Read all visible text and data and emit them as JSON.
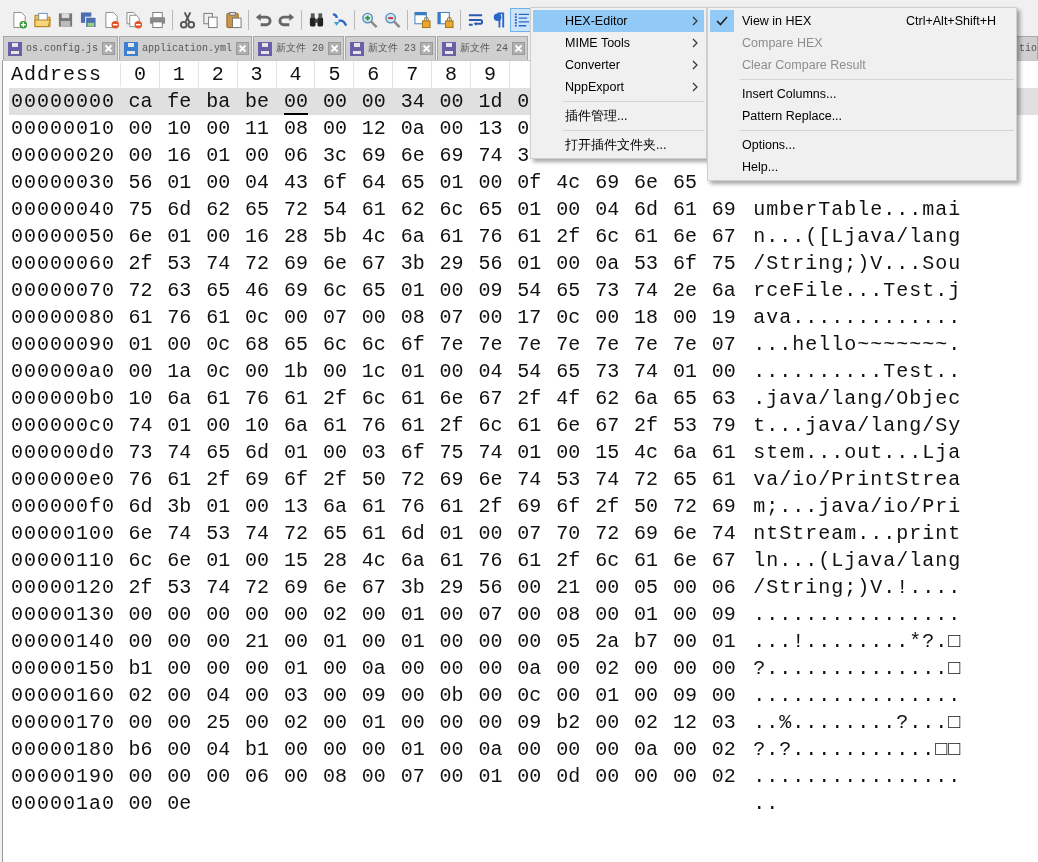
{
  "toolbar_groups": [
    [
      {
        "kind": "new",
        "selected": false
      },
      {
        "kind": "open",
        "selected": false
      },
      {
        "kind": "save",
        "selected": false
      },
      {
        "kind": "saveall",
        "selected": false
      },
      {
        "kind": "close",
        "selected": false
      },
      {
        "kind": "closeall",
        "selected": false
      },
      {
        "kind": "print",
        "selected": false
      }
    ],
    [
      {
        "kind": "cut",
        "selected": false
      },
      {
        "kind": "copy",
        "selected": false
      },
      {
        "kind": "paste",
        "selected": false
      }
    ],
    [
      {
        "kind": "undo",
        "selected": false
      },
      {
        "kind": "redo",
        "selected": false
      }
    ],
    [
      {
        "kind": "find",
        "selected": false
      },
      {
        "kind": "replace",
        "selected": false
      }
    ],
    [
      {
        "kind": "zoomin",
        "selected": false
      },
      {
        "kind": "zoomout",
        "selected": false
      }
    ],
    [
      {
        "kind": "syncv",
        "selected": false
      },
      {
        "kind": "synch",
        "selected": false
      }
    ],
    [
      {
        "kind": "wrap",
        "selected": false
      },
      {
        "kind": "pilcrow",
        "selected": false
      },
      {
        "kind": "indent",
        "selected": true
      }
    ]
  ],
  "tabs": [
    {
      "label": "os.config.js",
      "color": "#6b5fa8"
    },
    {
      "label": "application.yml",
      "color": "#3d7fd0"
    },
    {
      "label": "新文件 20",
      "color": "#6b5fa8"
    },
    {
      "label": "新文件 23",
      "color": "#6b5fa8"
    },
    {
      "label": "新文件 24",
      "color": "#6b5fa8"
    },
    {
      "label": "tio",
      "kind": "edge"
    }
  ],
  "hex_view": {
    "address_header": "Address",
    "columns": [
      "0",
      "1",
      "2",
      "3",
      "4",
      "5",
      "6",
      "7",
      "8",
      "9"
    ],
    "rows": [
      {
        "address": "00000000",
        "bytes": [
          "ca",
          "fe",
          "ba",
          "be",
          {
            "value": "00",
            "caret": true
          },
          "00",
          "00",
          "34",
          "00",
          "1d",
          "0"
        ],
        "selected": true
      },
      {
        "address": "00000010",
        "bytes": "00 10 00 11 08 00 12 0a 00 13 0",
        "selected": false
      },
      {
        "address": "00000020",
        "bytes": "00 16 01 00 06 3c 69 6e 69 74 3",
        "selected": false
      },
      {
        "address": "00000030",
        "bytes": "56 01 00 04 43 6f 64 65 01 00 0f 4c 69 6e 65",
        "selected": false
      },
      {
        "address": "00000040",
        "bytes": "75 6d 62 65 72 54 61 62 6c 65 01 00 04 6d 61 69",
        "ascii": "umberTable...mai",
        "selected": false
      },
      {
        "address": "00000050",
        "bytes": "6e 01 00 16 28 5b 4c 6a 61 76 61 2f 6c 61 6e 67",
        "ascii": "n...([Ljava/lang",
        "selected": false
      },
      {
        "address": "00000060",
        "bytes": "2f 53 74 72 69 6e 67 3b 29 56 01 00 0a 53 6f 75",
        "ascii": "/String;)V...Sou",
        "selected": false
      },
      {
        "address": "00000070",
        "bytes": "72 63 65 46 69 6c 65 01 00 09 54 65 73 74 2e 6a",
        "ascii": "rceFile...Test.j",
        "selected": false
      },
      {
        "address": "00000080",
        "bytes": "61 76 61 0c 00 07 00 08 07 00 17 0c 00 18 00 19",
        "ascii": "ava.............",
        "selected": false
      },
      {
        "address": "00000090",
        "bytes": "01 00 0c 68 65 6c 6c 6f 7e 7e 7e 7e 7e 7e 7e 07",
        "ascii": "...hello~~~~~~~.",
        "selected": false
      },
      {
        "address": "000000a0",
        "bytes": "00 1a 0c 00 1b 00 1c 01 00 04 54 65 73 74 01 00",
        "ascii": "..........Test..",
        "selected": false
      },
      {
        "address": "000000b0",
        "bytes": "10 6a 61 76 61 2f 6c 61 6e 67 2f 4f 62 6a 65 63",
        "ascii": ".java/lang/Objec",
        "selected": false
      },
      {
        "address": "000000c0",
        "bytes": "74 01 00 10 6a 61 76 61 2f 6c 61 6e 67 2f 53 79",
        "ascii": "t...java/lang/Sy",
        "selected": false
      },
      {
        "address": "000000d0",
        "bytes": "73 74 65 6d 01 00 03 6f 75 74 01 00 15 4c 6a 61",
        "ascii": "stem...out...Lja",
        "selected": false
      },
      {
        "address": "000000e0",
        "bytes": "76 61 2f 69 6f 2f 50 72 69 6e 74 53 74 72 65 61",
        "ascii": "va/io/PrintStrea",
        "selected": false
      },
      {
        "address": "000000f0",
        "bytes": "6d 3b 01 00 13 6a 61 76 61 2f 69 6f 2f 50 72 69",
        "ascii": "m;...java/io/Pri",
        "selected": false
      },
      {
        "address": "00000100",
        "bytes": "6e 74 53 74 72 65 61 6d 01 00 07 70 72 69 6e 74",
        "ascii": "ntStream...print",
        "selected": false
      },
      {
        "address": "00000110",
        "bytes": "6c 6e 01 00 15 28 4c 6a 61 76 61 2f 6c 61 6e 67",
        "ascii": "ln...(Ljava/lang",
        "selected": false
      },
      {
        "address": "00000120",
        "bytes": "2f 53 74 72 69 6e 67 3b 29 56 00 21 00 05 00 06",
        "ascii": "/String;)V.!....",
        "selected": false
      },
      {
        "address": "00000130",
        "bytes": "00 00 00 00 00 02 00 01 00 07 00 08 00 01 00 09",
        "ascii": "................",
        "selected": false
      },
      {
        "address": "00000140",
        "bytes": "00 00 00 21 00 01 00 01 00 00 00 05 2a b7 00 01",
        "ascii": "...!........*?.□",
        "selected": false
      },
      {
        "address": "00000150",
        "bytes": "b1 00 00 00 01 00 0a 00 00 00 0a 00 02 00 00 00",
        "ascii": "?..............□",
        "selected": false
      },
      {
        "address": "00000160",
        "bytes": "02 00 04 00 03 00 09 00 0b 00 0c 00 01 00 09 00",
        "ascii": "................",
        "selected": false
      },
      {
        "address": "00000170",
        "bytes": "00 00 25 00 02 00 01 00 00 00 09 b2 00 02 12 03",
        "ascii": "..%........?...□",
        "selected": false
      },
      {
        "address": "00000180",
        "bytes": "b6 00 04 b1 00 00 00 01 00 0a 00 00 00 0a 00 02",
        "ascii": "?.?...........□□",
        "selected": false
      },
      {
        "address": "00000190",
        "bytes": "00 00 00 06 00 08 00 07 00 01 00 0d 00 00 00 02",
        "ascii": "................",
        "selected": false
      },
      {
        "address": "000001a0",
        "bytes": "00 0e",
        "ascii": "..",
        "selected": false
      }
    ]
  },
  "plugin_menu": [
    {
      "kind": "item",
      "label": "HEX-Editor",
      "submenu": true,
      "selected": true
    },
    {
      "kind": "item",
      "label": "MIME Tools",
      "submenu": true,
      "selected": false
    },
    {
      "kind": "item",
      "label": "Converter",
      "submenu": true,
      "selected": false
    },
    {
      "kind": "item",
      "label": "NppExport",
      "submenu": true,
      "selected": false
    },
    {
      "kind": "separator"
    },
    {
      "kind": "item",
      "label": "插件管理...",
      "submenu": false,
      "selected": false
    },
    {
      "kind": "separator"
    },
    {
      "kind": "item",
      "label": "打开插件文件夹...",
      "submenu": false,
      "selected": false
    }
  ],
  "hex_submenu": [
    {
      "kind": "item",
      "label": "View in HEX",
      "shortcut": "Ctrl+Alt+Shift+H",
      "checked": true,
      "disabled": false
    },
    {
      "kind": "item",
      "label": "Compare HEX",
      "checked": false,
      "disabled": true
    },
    {
      "kind": "item",
      "label": "Clear Compare Result",
      "checked": false,
      "disabled": true
    },
    {
      "kind": "separator"
    },
    {
      "kind": "item",
      "label": "Insert Columns...",
      "checked": false,
      "disabled": false
    },
    {
      "kind": "item",
      "label": "Pattern Replace...",
      "checked": false,
      "disabled": false
    },
    {
      "kind": "separator"
    },
    {
      "kind": "item",
      "label": "Options...",
      "checked": false,
      "disabled": false
    },
    {
      "kind": "item",
      "label": "Help...",
      "checked": false,
      "disabled": false
    }
  ]
}
